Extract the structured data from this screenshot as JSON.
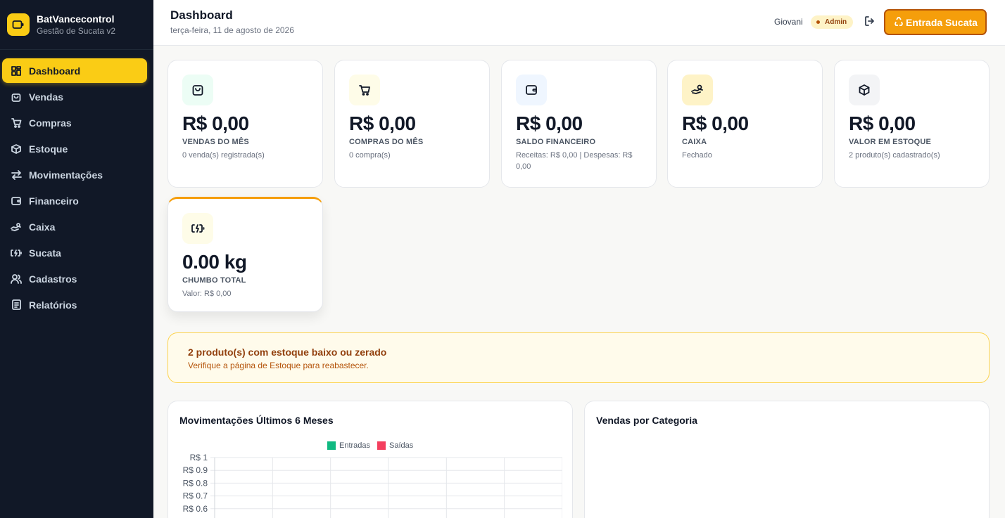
{
  "brand": {
    "name": "BatVancecontrol",
    "subtitle": "Gestão de Sucata v2"
  },
  "nav": [
    {
      "label": "Dashboard",
      "icon": "dashboard-icon",
      "active": true
    },
    {
      "label": "Vendas",
      "icon": "shopping-bag-icon"
    },
    {
      "label": "Compras",
      "icon": "cart-icon"
    },
    {
      "label": "Estoque",
      "icon": "box-icon"
    },
    {
      "label": "Movimentações",
      "icon": "arrows-exchange-icon"
    },
    {
      "label": "Financeiro",
      "icon": "wallet-icon"
    },
    {
      "label": "Caixa",
      "icon": "hand-coins-icon"
    },
    {
      "label": "Sucata",
      "icon": "battery-icon"
    },
    {
      "label": "Cadastros",
      "icon": "users-icon"
    },
    {
      "label": "Relatórios",
      "icon": "report-icon"
    }
  ],
  "header": {
    "title": "Dashboard",
    "date": "terça-feira, 11 de agosto de 2026",
    "user": "Giovani",
    "role": "Admin",
    "cta_label": "Entrada Sucata"
  },
  "cards": [
    {
      "value": "R$ 0,00",
      "label": "VENDAS DO MÊS",
      "detail": "0 venda(s) registrada(s)",
      "icon": "shopping-bag-icon",
      "icon_bg": "#ecfdf5"
    },
    {
      "value": "R$ 0,00",
      "label": "COMPRAS DO MÊS",
      "detail": "0 compra(s)",
      "icon": "cart-icon",
      "icon_bg": "#fefce8"
    },
    {
      "value": "R$ 0,00",
      "label": "SALDO FINANCEIRO",
      "detail": "Receitas: R$ 0,00 | Despesas: R$ 0,00",
      "icon": "wallet-icon",
      "icon_bg": "#eff6ff"
    },
    {
      "value": "R$ 0,00",
      "label": "CAIXA",
      "detail": "Fechado",
      "icon": "hand-coins-icon",
      "icon_bg": "#fef3c7"
    },
    {
      "value": "R$ 0,00",
      "label": "VALOR EM ESTOQUE",
      "detail": "2 produto(s) cadastrado(s)",
      "icon": "box-icon",
      "icon_bg": "#f3f4f6"
    },
    {
      "value": "0.00 kg",
      "label": "CHUMBO TOTAL",
      "detail": "Valor: R$ 0,00",
      "icon": "battery-icon",
      "icon_bg": "#fefce8"
    }
  ],
  "alert": {
    "title": "2 produto(s) com estoque baixo ou zerado",
    "text": "Verifique a página de Estoque para reabastecer."
  },
  "panels": {
    "movements_title": "Movimentações Últimos 6 Meses",
    "category_title": "Vendas por Categoria"
  },
  "colors": {
    "accent": "#facc15",
    "cta": "#f59e0b",
    "sidebar": "#111827",
    "entradas": "#10b981",
    "saidas": "#f43f5e"
  },
  "chart_data": {
    "type": "bar",
    "title": "Movimentações Últimos 6 Meses",
    "series": [
      {
        "name": "Entradas",
        "values": []
      },
      {
        "name": "Saídas",
        "values": []
      }
    ],
    "y_ticks": [
      "R$ 1",
      "R$ 0.9",
      "R$ 0.8",
      "R$ 0.7",
      "R$ 0.6"
    ],
    "ylim": [
      0,
      1
    ],
    "grid": true,
    "legend": "top-center"
  }
}
